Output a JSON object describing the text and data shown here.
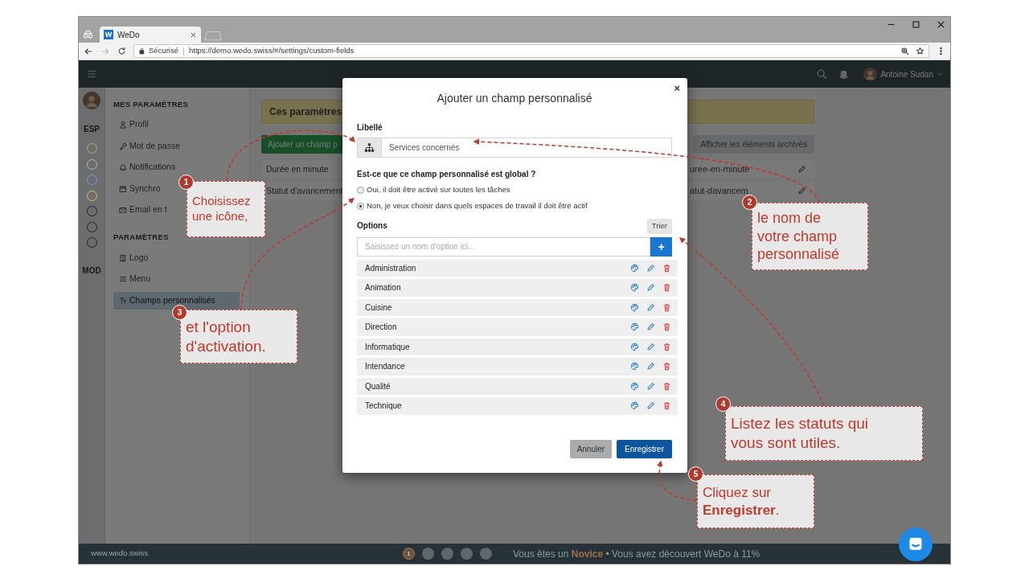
{
  "browser": {
    "tab_favicon": "W",
    "tab_title": "WeDo",
    "security_label": "Sécurisé",
    "url": "https://demo.wedo.swiss/#/settings/custom-fields"
  },
  "topbar": {
    "user_name": "Antoine Sudan"
  },
  "rail": {
    "space_label": "ESP",
    "dots": [
      {
        "color": "#c9a55c"
      },
      {
        "color": "#b5b5b5"
      },
      {
        "color": "#6f9fd6"
      },
      {
        "color": "#d8c25a"
      },
      {
        "color": "#222222"
      },
      {
        "color": "#222222"
      },
      {
        "color": "#222222"
      }
    ],
    "mode_label": "MOD"
  },
  "sidebar": {
    "sections": [
      {
        "title": "MES PARAMÈTRES",
        "items": [
          {
            "label": "Profil",
            "selected": false
          },
          {
            "label": "Mot de passe",
            "selected": false
          },
          {
            "label": "Notifications",
            "selected": false
          },
          {
            "label": "Synchro",
            "selected": false
          },
          {
            "label": "Email en t",
            "selected": false
          }
        ]
      },
      {
        "title": "PARAMÈTRES",
        "items": [
          {
            "label": "Logo",
            "selected": false
          },
          {
            "label": "Menu",
            "selected": false
          },
          {
            "label": "Champs personnalisés",
            "selected": true
          }
        ]
      }
    ]
  },
  "main": {
    "banner": "Ces paramètres",
    "add_button": "Ajouter un champ p",
    "archive_button": "Afficher les éléments archivés",
    "fields": [
      {
        "label": "Durée en minute",
        "slug": "uree-en-minute"
      },
      {
        "label": "Statut d'avancement",
        "slug": "atut-davancem"
      }
    ]
  },
  "modal": {
    "title": "Ajouter un champ personnalisé",
    "close": "×",
    "name_label": "Libellé",
    "name_value": "Services concernés",
    "global_question": "Est-ce que ce champ personnalisé est global ?",
    "radios": [
      {
        "label": "Oui, il doit être activé sur toutes les tâches",
        "selected": false
      },
      {
        "label": "Non, je veux choisir dans quels espaces de travail il doit être actif",
        "selected": true
      }
    ],
    "options_label": "Options",
    "sort_button": "Trier",
    "option_placeholder": "Saisissez un nom d'option ici...",
    "add_button": "+",
    "options": [
      "Administration",
      "Animation",
      "Cuisine",
      "Direction",
      "Informatique",
      "Intendance",
      "Qualité",
      "Technique"
    ],
    "cancel_button": "Annuler",
    "save_button": "Enregistrer"
  },
  "footer": {
    "site": "www.wedo.swiss",
    "steps": [
      {
        "label": "1",
        "selected": true
      },
      {
        "selected": false
      },
      {
        "selected": false
      },
      {
        "selected": false
      },
      {
        "selected": false
      }
    ],
    "progress": "Vous êtes un **Novice** • Vous avez découvert WeDo à 11%"
  },
  "callouts": [
    {
      "number": "1",
      "lines": [
        "Choisissez",
        "une icône,"
      ]
    },
    {
      "number": "2",
      "lines": [
        "le nom de",
        "votre champ",
        "personnalisé"
      ]
    },
    {
      "number": "3",
      "lines": [
        "et l'option",
        "d'activation."
      ]
    },
    {
      "number": "4",
      "lines": [
        "Listez les statuts qui",
        "vous sont utiles."
      ]
    },
    {
      "number": "5",
      "lines": [
        "Cliquez sur",
        "**Enregistrer**."
      ]
    }
  ]
}
